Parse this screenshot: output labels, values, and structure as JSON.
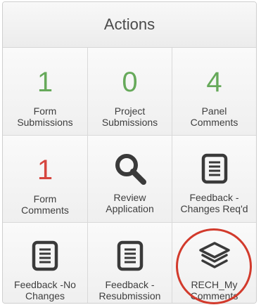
{
  "header": {
    "title": "Actions"
  },
  "tiles": [
    {
      "value": "1",
      "label": "Form\nSubmissions"
    },
    {
      "value": "0",
      "label": "Project\nSubmissions"
    },
    {
      "value": "4",
      "label": "Panel\nComments"
    },
    {
      "value": "1",
      "label": "Form\nComments"
    },
    {
      "icon": "search-icon",
      "label": "Review\nApplication"
    },
    {
      "icon": "document-icon",
      "label": "Feedback -\nChanges Req'd"
    },
    {
      "icon": "document-icon",
      "label": "Feedback -No\nChanges"
    },
    {
      "icon": "document-icon",
      "label": "Feedback -\nResubmission"
    },
    {
      "icon": "layers-icon",
      "label": "RECH_My\nComments"
    }
  ],
  "colors": {
    "count_green": "#66a95a",
    "count_red": "#d6463f",
    "highlight_circle": "#d23a2c",
    "icon": "#3a3a3a"
  }
}
